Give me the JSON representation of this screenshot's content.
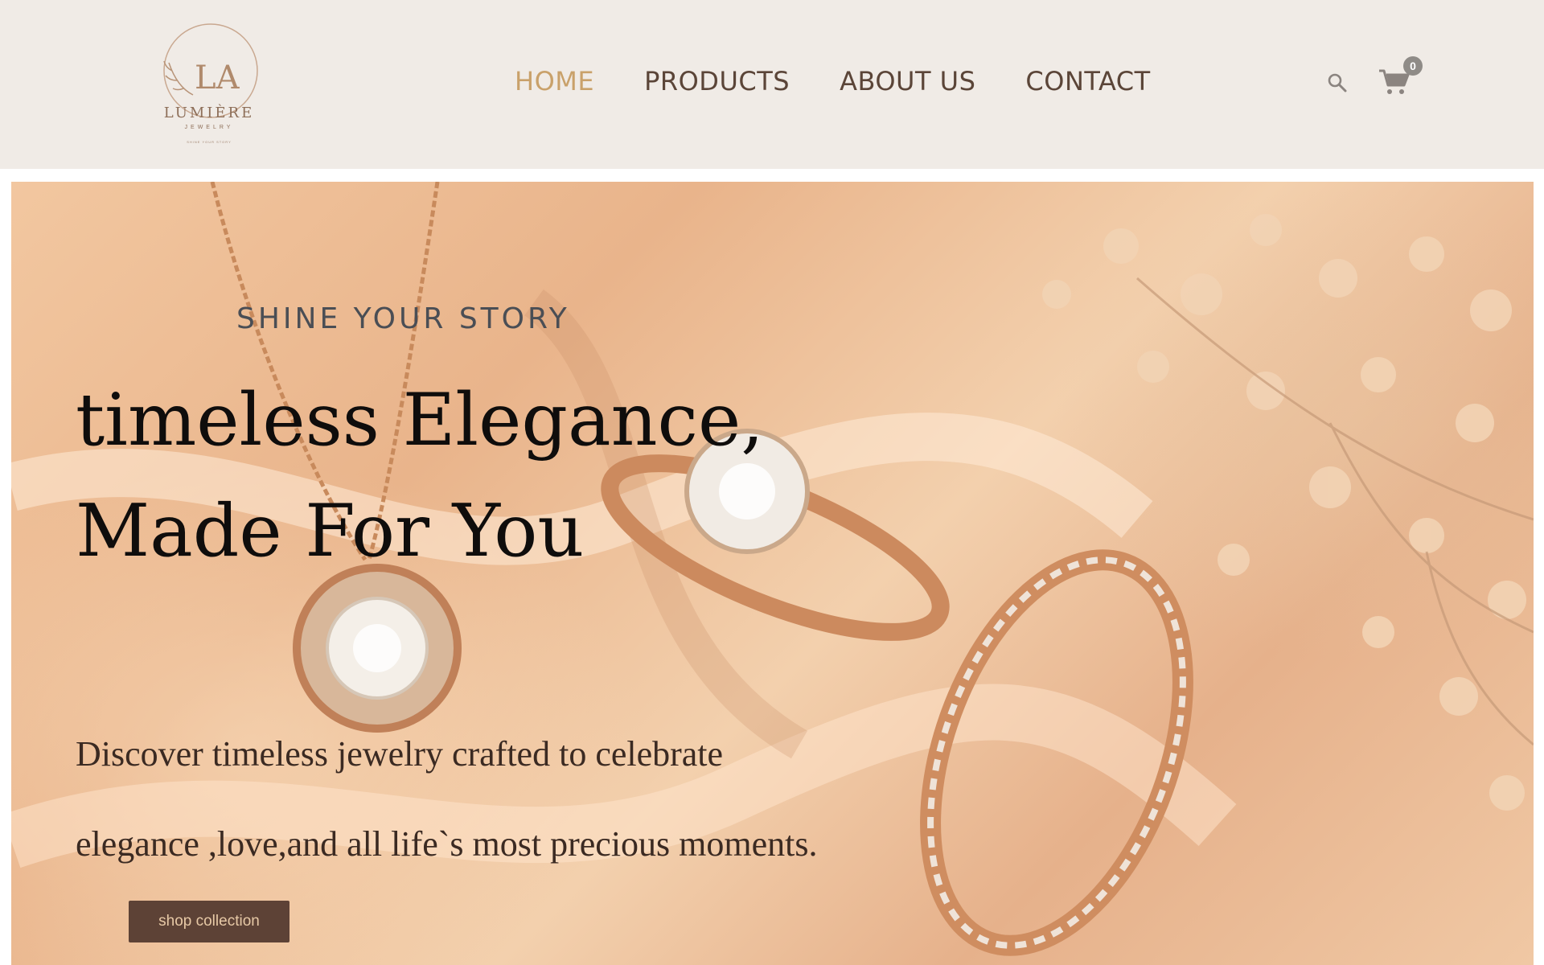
{
  "brand": {
    "logo_monogram": "LA",
    "logo_name": "LUMIÈRE",
    "logo_sub": "JEWELRY",
    "logo_tagline": "SHINE YOUR STORY"
  },
  "nav": {
    "items": [
      {
        "label": "HOME",
        "active": true
      },
      {
        "label": "PRODUCTS",
        "active": false
      },
      {
        "label": "ABOUT US",
        "active": false
      },
      {
        "label": "CONTACT",
        "active": false
      }
    ]
  },
  "header_actions": {
    "search_icon": "search-icon",
    "cart_icon": "cart-icon",
    "cart_count": "0"
  },
  "hero": {
    "eyebrow": "SHINE YOUR STORY",
    "headline_line1": "timeless Elegance,",
    "headline_line2": "Made For You",
    "sub_line1": "Discover timeless jewelry crafted to celebrate",
    "sub_line2": "elegance ,love,and all life`s most precious moments.",
    "cta_label": "shop collection"
  },
  "colors": {
    "header_bg": "#f0ebe6",
    "nav_text": "#5b4538",
    "nav_active": "#c9a16a",
    "cta_bg": "#5d4236",
    "cta_text": "#e7c9a6"
  }
}
